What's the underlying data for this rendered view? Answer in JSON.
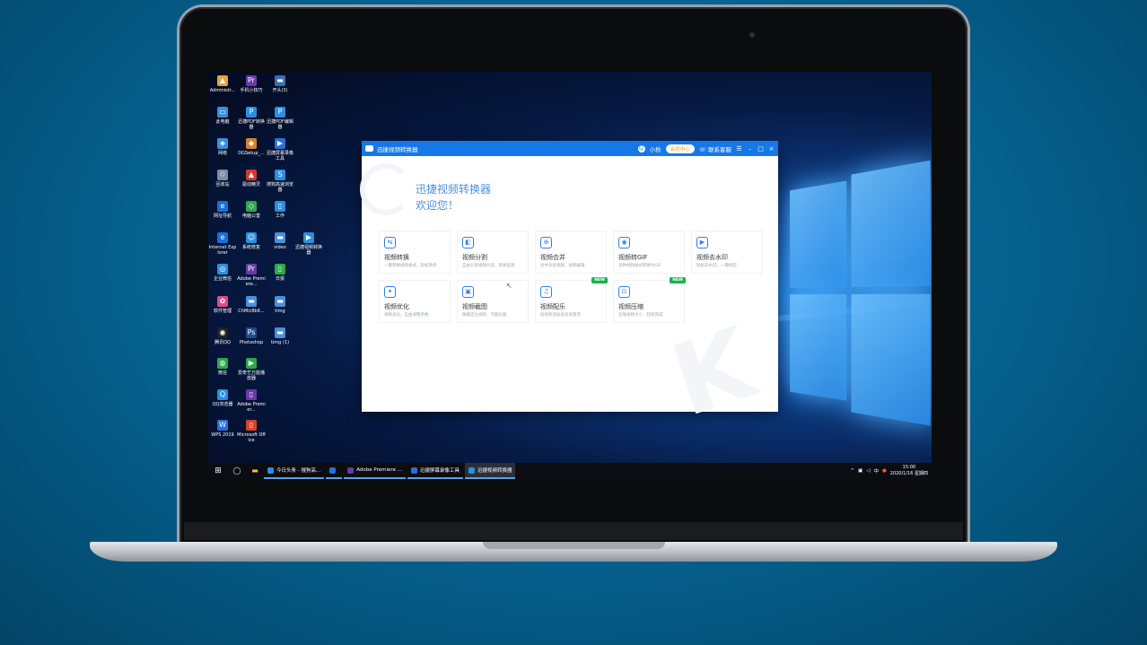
{
  "desktop_icons": [
    {
      "label": "Administr...",
      "color": "#e6a23c",
      "glyph": "▲"
    },
    {
      "label": "手机小技巧",
      "color": "#6a3aa8",
      "glyph": "Pr"
    },
    {
      "label": "开头(3)",
      "color": "#3b6fb0",
      "glyph": "▬"
    },
    {
      "label": "此电脑",
      "color": "#3a8fd8",
      "glyph": "▭"
    },
    {
      "label": "迅捷PDF转换器",
      "color": "#2a8fe0",
      "glyph": "P"
    },
    {
      "label": "迅捷PDF编辑器",
      "color": "#2a8fe0",
      "glyph": "P"
    },
    {
      "label": "网络",
      "color": "#3a8fd8",
      "glyph": "◈"
    },
    {
      "label": "DGSetup_...",
      "color": "#d8802a",
      "glyph": "◆"
    },
    {
      "label": "迅捷屏幕录像工具",
      "color": "#2a6fd8",
      "glyph": "▶"
    },
    {
      "label": "回收站",
      "color": "#7c8ea6",
      "glyph": "♲"
    },
    {
      "label": "驱动精灵",
      "color": "#d23a2a",
      "glyph": "▲"
    },
    {
      "label": "搜狗高速浏览器",
      "color": "#2a8fe0",
      "glyph": "S"
    },
    {
      "label": "网址导航",
      "color": "#1a6fd8",
      "glyph": "e"
    },
    {
      "label": "电脑公害",
      "color": "#2fa84a",
      "glyph": "◇"
    },
    {
      "label": "工作",
      "color": "#2a8fe0",
      "glyph": "▯"
    },
    {
      "label": "Internet Explorer",
      "color": "#1a6fd8",
      "glyph": "e"
    },
    {
      "label": "系统修复",
      "color": "#2a8fe0",
      "glyph": "☺"
    },
    {
      "label": "video",
      "color": "#4a90d8",
      "glyph": "▬"
    },
    {
      "label": "迅捷视频转换器",
      "color": "#2a8fe0",
      "glyph": "▶"
    },
    {
      "label": "企业微信",
      "color": "#2a8fe0",
      "glyph": "◎"
    },
    {
      "label": "Adobe Premiere...",
      "color": "#6a3aa8",
      "glyph": "Pr"
    },
    {
      "label": "日报",
      "color": "#2fa84a",
      "glyph": "▯"
    },
    {
      "label": "软件管理",
      "color": "#e04a8a",
      "glyph": "✿"
    },
    {
      "label": "ChMicBkK...",
      "color": "#4a90d8",
      "glyph": "▬"
    },
    {
      "label": "timg",
      "color": "#4a90d8",
      "glyph": "▬"
    },
    {
      "label": "腾讯QQ",
      "color": "#222",
      "glyph": "◉"
    },
    {
      "label": "Photoshop",
      "color": "#1f4b8f",
      "glyph": "Ps"
    },
    {
      "label": "timg (1)",
      "color": "#4a90d8",
      "glyph": "▬"
    },
    {
      "label": "微信",
      "color": "#2fa84a",
      "glyph": "◍"
    },
    {
      "label": "爱奇艺万能播放器",
      "color": "#2fa84a",
      "glyph": "▶"
    },
    {
      "label": "QQ浏览器",
      "color": "#2a8fe0",
      "glyph": "Q"
    },
    {
      "label": "Adobe Premier...",
      "color": "#6a3aa8",
      "glyph": "▯"
    },
    {
      "label": "WPS 2019",
      "color": "#2a6fd8",
      "glyph": "W"
    },
    {
      "label": "Microsoft Office",
      "color": "#d8432a",
      "glyph": "▯"
    }
  ],
  "taskbar": {
    "apps": [
      {
        "label": "今日头条 - 搜狗高...",
        "color": "#2a8fe0",
        "active": false
      },
      {
        "label": "",
        "color": "#2a6fd8",
        "active": false
      },
      {
        "label": "Adobe Premiere ...",
        "color": "#6a3aa8",
        "active": false
      },
      {
        "label": "迅捷屏幕录像工具",
        "color": "#2a6fd8",
        "active": false
      },
      {
        "label": "迅捷视频转换器",
        "color": "#2a8fe0",
        "active": true
      }
    ],
    "tray_lang": "中",
    "time": "15:00",
    "date": "2020/1/16 星期四"
  },
  "app": {
    "title": "迅捷视频转换器",
    "username": "小秋",
    "member_center": "会员中心",
    "contact": "联系客服",
    "welcome_line1": "迅捷视频转换器",
    "welcome_line2": "欢迎您！",
    "tiles": [
      {
        "name": "视频转换",
        "desc": "一键转换视频格式，轻松简单",
        "glyph": "⇆",
        "new": false
      },
      {
        "name": "视频分割",
        "desc": "自由分割视频片段，简易直观",
        "glyph": "◧",
        "new": false
      },
      {
        "name": "视频合并",
        "desc": "合并多段视频，视频编辑",
        "glyph": "⊕",
        "new": false
      },
      {
        "name": "视频转GIF",
        "desc": "多种视频格式转换为GIF",
        "glyph": "◉",
        "new": false
      },
      {
        "name": "视频去水印",
        "desc": "轻松去水印，一键搞定",
        "glyph": "▶",
        "new": false
      },
      {
        "name": "视频优化",
        "desc": "视频美化，自由调整参数",
        "glyph": "✦",
        "new": false
      },
      {
        "name": "视频截图",
        "desc": "精确定位视频，可截长图",
        "glyph": "▣",
        "new": false
      },
      {
        "name": "视频配乐",
        "desc": "给视频添加多段背景音",
        "glyph": "♫",
        "new": true
      },
      {
        "name": "视频压缩",
        "desc": "压缩视频大小，轻松完成",
        "glyph": "⊡",
        "new": true
      }
    ],
    "new_badge": "NEW"
  }
}
